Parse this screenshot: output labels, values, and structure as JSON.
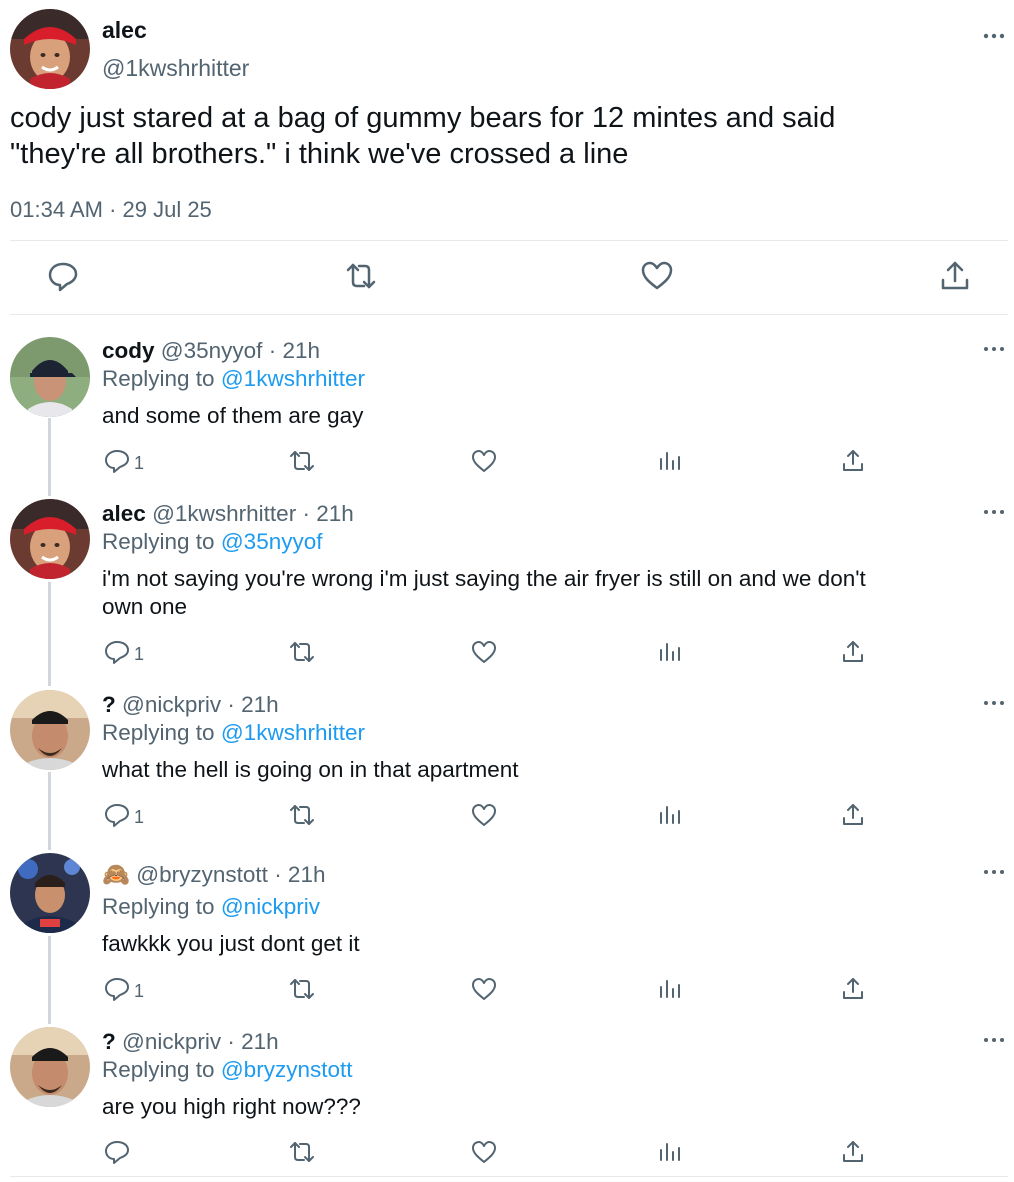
{
  "main_tweet": {
    "author_name": "alec",
    "author_handle": "@1kwshrhitter",
    "text_line1": "cody just stared at a bag of gummy bears for 12 mintes and said",
    "text_line2": "\"they're all brothers.\" i think we've crossed a line",
    "timestamp": "01:34 AM · 29 Jul 25",
    "actions": [
      "reply-icon",
      "retweet-icon",
      "like-icon",
      "share-icon"
    ]
  },
  "replies": [
    {
      "name": "cody",
      "handle": "@35nyyof",
      "time": "· 21h",
      "replying_prefix": "Replying to",
      "replying_to": "@1kwshrhitter",
      "text_lines": [
        "and some of them are gay"
      ],
      "reply_count": "1"
    },
    {
      "name": "alec",
      "handle": "@1kwshrhitter",
      "time": "· 21h",
      "replying_prefix": "Replying to",
      "replying_to": "@35nyyof",
      "text_lines": [
        "i'm not saying you're wrong i'm just saying the air fryer is still on and we don't",
        "own one"
      ],
      "reply_count": "1"
    },
    {
      "name": "?",
      "handle": "@nickpriv",
      "time": "· 21h",
      "replying_prefix": "Replying to",
      "replying_to": "@1kwshrhitter",
      "text_lines": [
        "what the hell is going on in that apartment"
      ],
      "reply_count": "1"
    },
    {
      "name": "🙈",
      "handle": "@bryzynstott",
      "time": "· 21h",
      "replying_prefix": "Replying to",
      "replying_to": "@nickpriv",
      "text_lines": [
        "fawkkk you just dont get it"
      ],
      "reply_count": "1"
    },
    {
      "name": "?",
      "handle": "@nickpriv",
      "time": "· 21h",
      "replying_prefix": "Replying to",
      "replying_to": "@bryzynstott",
      "text_lines": [
        "are you high right now???"
      ],
      "reply_count": ""
    }
  ],
  "colors": {
    "text": "#0f1419",
    "secondary": "#536471",
    "link": "#1d9bf0",
    "divider": "#e6e9eb",
    "thread_line": "#d0d6da"
  }
}
